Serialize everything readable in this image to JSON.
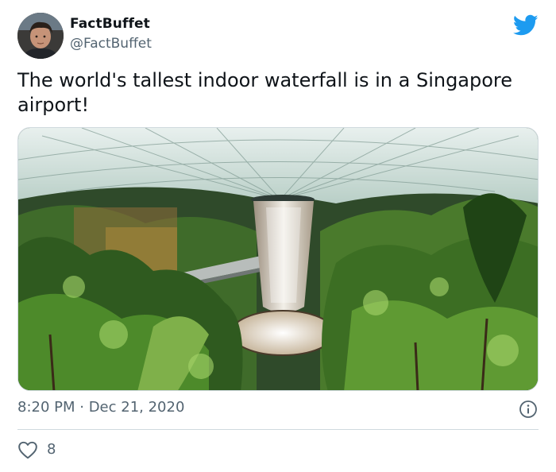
{
  "tweet": {
    "display_name": "FactBuffet",
    "handle": "@FactBuffet",
    "text": "The world's tallest indoor waterfall is in a Singapore airport!",
    "timestamp": "8:20 PM · Dec 21, 2020",
    "likes": "8"
  },
  "icons": {
    "brand": "twitter-bird-icon",
    "info": "info-icon",
    "like": "heart-icon"
  },
  "colors": {
    "twitter_blue": "#1d9bf0",
    "text": "#0f1419",
    "secondary": "#536471",
    "divider": "#cfd9de"
  }
}
